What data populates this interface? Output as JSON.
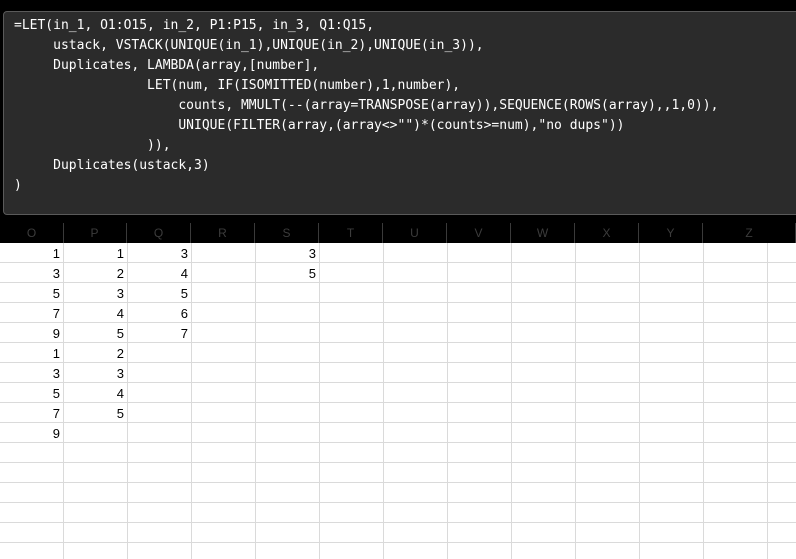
{
  "formula": {
    "lines": [
      "=LET(in_1, O1:O15, in_2, P1:P15, in_3, Q1:Q15,",
      "     ustack, VSTACK(UNIQUE(in_1),UNIQUE(in_2),UNIQUE(in_3)),",
      "     Duplicates, LAMBDA(array,[number],",
      "                 LET(num, IF(ISOMITTED(number),1,number),",
      "                     counts, MMULT(--(array=TRANSPOSE(array)),SEQUENCE(ROWS(array),,1,0)),",
      "                     UNIQUE(FILTER(array,(array<>\"\")*(counts>=num),\"no dups\"))",
      "                 )),",
      "     Duplicates(ustack,3)",
      ")"
    ]
  },
  "columns": [
    "O",
    "P",
    "Q",
    "R",
    "S",
    "T",
    "U",
    "V",
    "W",
    "X",
    "Y",
    "Z"
  ],
  "cells": {
    "col_O": [
      "1",
      "3",
      "5",
      "7",
      "9",
      "1",
      "3",
      "5",
      "7",
      "9"
    ],
    "col_P": [
      "1",
      "2",
      "3",
      "4",
      "5",
      "2",
      "3",
      "4",
      "5"
    ],
    "col_Q": [
      "3",
      "4",
      "5",
      "6",
      "7"
    ],
    "col_S": [
      "3",
      "5"
    ]
  }
}
